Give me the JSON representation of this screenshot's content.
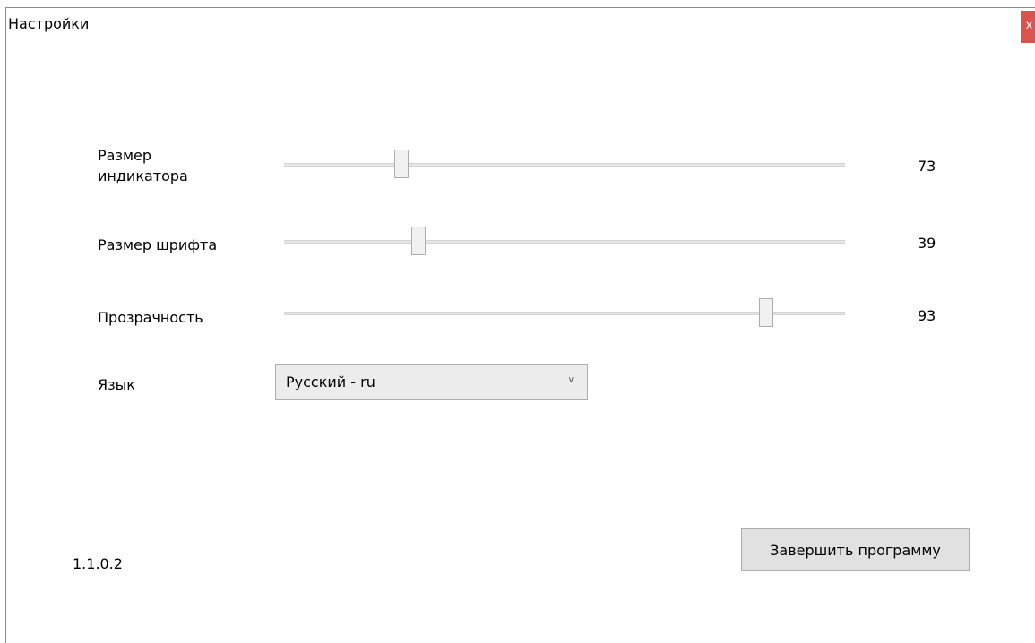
{
  "window": {
    "title": "Настройки",
    "close_label": "x",
    "close_color": "#d9534f"
  },
  "settings": [
    {
      "label": "Размер индикатора",
      "value": "73",
      "position_fraction": 0.21
    },
    {
      "label": "Размер шрифта",
      "value": "39",
      "position_fraction": 0.24
    },
    {
      "label": "Прозрачность",
      "value": "93",
      "position_fraction": 0.86
    }
  ],
  "language": {
    "label": "Язык",
    "selected": "Русский - ru",
    "arrow_icon": "chevron-down-icon"
  },
  "footer": {
    "version": "1.1.0.2",
    "exit_label": "Завершить программу"
  }
}
